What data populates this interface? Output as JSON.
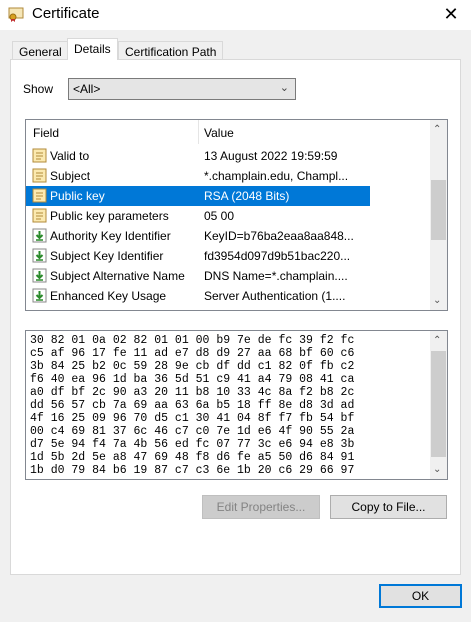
{
  "window": {
    "title": "Certificate"
  },
  "tabs": [
    {
      "label": "General"
    },
    {
      "label": "Details"
    },
    {
      "label": "Certification Path"
    }
  ],
  "show": {
    "label": "Show",
    "selected": "<All>"
  },
  "list": {
    "headers": {
      "field": "Field",
      "value": "Value"
    },
    "rows": [
      {
        "field": "Valid to",
        "value": "13 August 2022 19:59:59",
        "icon": "certificate-field-icon"
      },
      {
        "field": "Subject",
        "value": "*.champlain.edu, Champl...",
        "icon": "certificate-field-icon"
      },
      {
        "field": "Public key",
        "value": "RSA (2048 Bits)",
        "icon": "certificate-field-icon"
      },
      {
        "field": "Public key parameters",
        "value": "05 00",
        "icon": "certificate-field-icon"
      },
      {
        "field": "Authority Key Identifier",
        "value": "KeyID=b76ba2eaa8aa848...",
        "icon": "extension-icon"
      },
      {
        "field": "Subject Key Identifier",
        "value": "fd3954d097d9b51bac220...",
        "icon": "extension-icon"
      },
      {
        "field": "Subject Alternative Name",
        "value": "DNS Name=*.champlain....",
        "icon": "extension-icon"
      },
      {
        "field": "Enhanced Key Usage",
        "value": "Server Authentication (1....",
        "icon": "extension-icon"
      }
    ]
  },
  "hex": {
    "lines": [
      "30 82 01 0a 02 82 01 01 00 b9 7e de fc 39 f2 fc",
      "c5 af 96 17 fe 11 ad e7 d8 d9 27 aa 68 bf 60 c6",
      "3b 84 25 b2 0c 59 28 9e cb df dd c1 82 0f fb c2",
      "f6 40 ea 96 1d ba 36 5d 51 c9 41 a4 79 08 41 ca",
      "a0 df bf 2c 90 a3 20 11 b8 10 33 4c 8a f2 b8 2c",
      "dd 56 57 cb 7a 69 aa 63 6a b5 18 ff 8e d8 3d ad",
      "4f 16 25 09 96 70 d5 c1 30 41 04 8f f7 fb 54 bf",
      "00 c4 69 81 37 6c 46 c7 c0 7e 1d e6 4f 90 55 2a",
      "d7 5e 94 f4 7a 4b 56 ed fc 07 77 3c e6 94 e8 3b",
      "1d 5b 2d 5e a8 47 69 48 f8 d6 fe a5 50 d6 84 91",
      "1b d0 79 84 b6 19 87 c7 c3 6e 1b 20 c6 29 66 97"
    ]
  },
  "buttons": {
    "edit_properties": "Edit Properties...",
    "copy_to_file": "Copy to File...",
    "ok": "OK"
  }
}
